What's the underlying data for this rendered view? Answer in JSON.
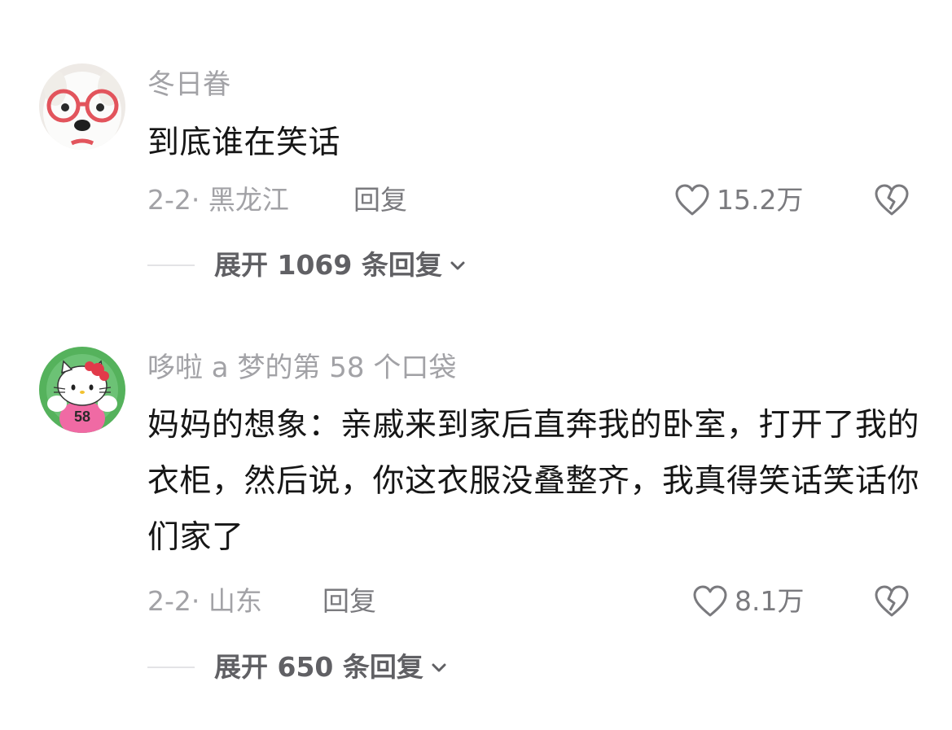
{
  "comments": [
    {
      "avatar_icon": "dog-with-red-glasses-avatar",
      "username": "冬日眷",
      "text": "到底谁在笑话",
      "meta": "2-2· 黑龙江",
      "reply_label": "回复",
      "like_count": "15.2万",
      "expand_label": "展开 1069 条回复"
    },
    {
      "avatar_icon": "hello-kitty-avatar",
      "avatar_badge": "58",
      "username": "哆啦 a 梦的第 58 个口袋",
      "text": "妈妈的想象：亲戚来到家后直奔我的卧室，打开了我的衣柜，然后说，你这衣服没叠整齐，我真得笑话笑话你们家了",
      "meta": "2-2· 山东",
      "reply_label": "回复",
      "like_count": "8.1万",
      "expand_label": "展开 650 条回复"
    }
  ],
  "colors": {
    "text_primary": "#161616",
    "text_secondary": "#a2a2a6",
    "action_text": "#7a7a7e",
    "expand_text": "#606064",
    "divider": "#e3e3e6"
  }
}
